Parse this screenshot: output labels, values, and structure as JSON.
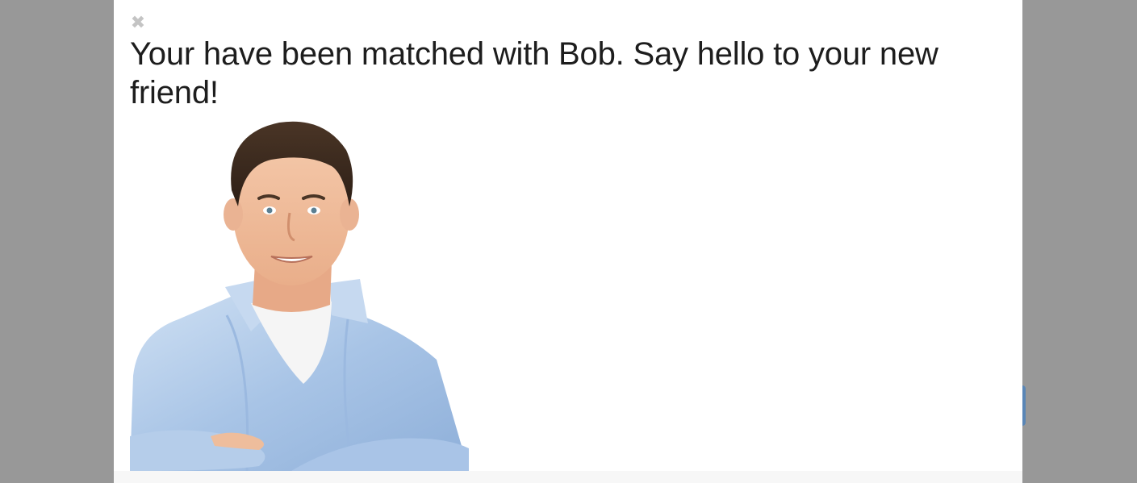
{
  "modal": {
    "close_glyph": "✖",
    "title": "Your have been matched with Bob. Say hello to your new friend!"
  },
  "colors": {
    "backdrop": "#989898",
    "modal_background": "#ffffff",
    "title_text": "#1d1d1d",
    "close_icon": "#c4c4c4",
    "background_button": "#5a86b6"
  }
}
